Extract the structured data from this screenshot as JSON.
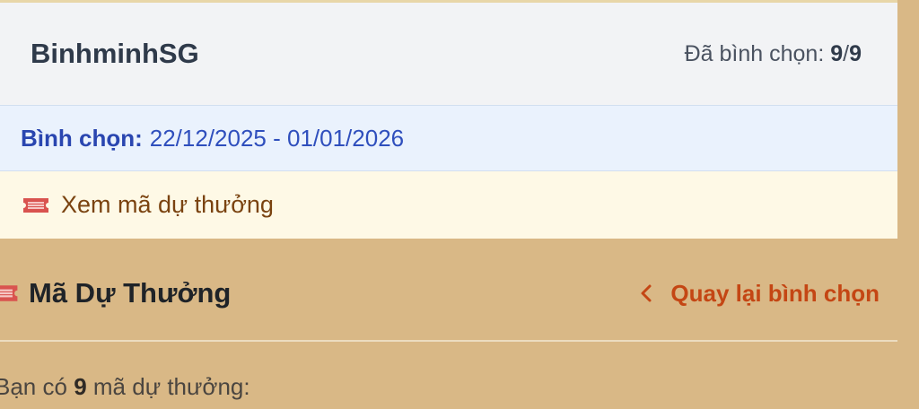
{
  "header": {
    "username": "BinhminhSG",
    "votes_label": "Đã bình chọn:",
    "votes_done": "9",
    "votes_sep": "/",
    "votes_total": "9"
  },
  "period": {
    "label": "Bình chọn:",
    "range": "22/12/2025 - 01/01/2026"
  },
  "tickets_link": {
    "icon": "ticket-icon",
    "label": "Xem mã dự thưởng"
  },
  "section": {
    "icon": "ticket-icon",
    "title": "Mã Dự Thưởng",
    "back_icon": "chevron-left-icon",
    "back_label": "Quay lại bình chọn"
  },
  "summary": {
    "prefix": "Bạn có",
    "count": "9",
    "suffix": "mã dự thưởng:"
  },
  "colors": {
    "page_bg": "#d9b886",
    "header_bg": "#f2f3f5",
    "period_bg": "#eaf2fd",
    "period_text": "#2f4fbd",
    "link_bg": "#fef9e6",
    "link_text": "#7a4310",
    "back_link": "#c44614",
    "ticket_icon": "#d9534f"
  }
}
